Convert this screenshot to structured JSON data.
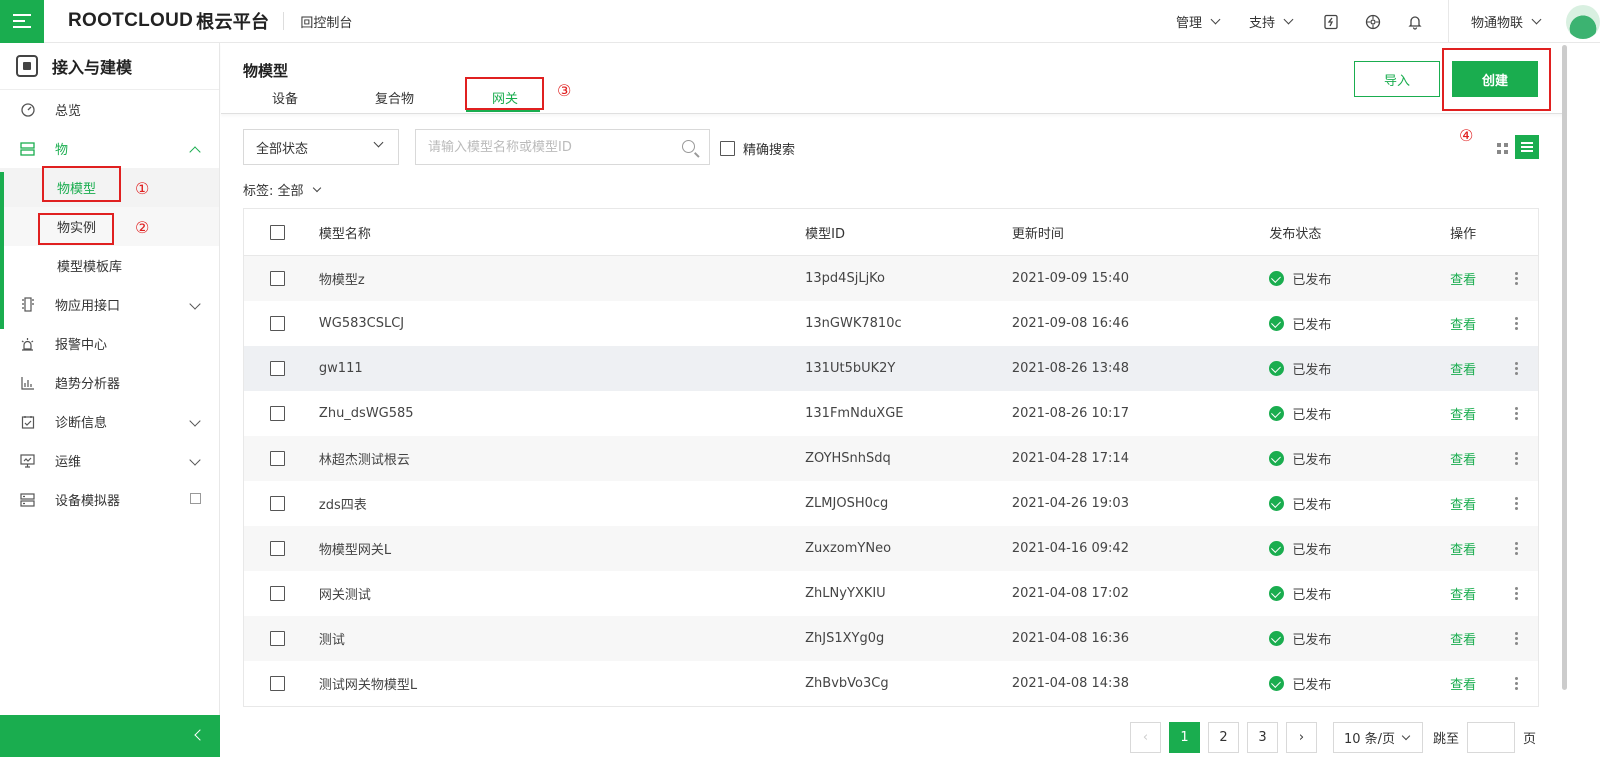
{
  "topbar": {
    "brand": "ROOTCLOUD",
    "brand_cn": "根云平台",
    "console": "回控制台",
    "manage": "管理",
    "support": "支持",
    "account": "物通物联"
  },
  "sidebar": {
    "title": "接入与建模",
    "items": [
      {
        "label": "总览"
      },
      {
        "label": "物"
      },
      {
        "label": "物应用接口"
      },
      {
        "label": "报警中心"
      },
      {
        "label": "趋势分析器"
      },
      {
        "label": "诊断信息"
      },
      {
        "label": "运维"
      },
      {
        "label": "设备模拟器"
      }
    ],
    "sub_items": [
      {
        "label": "物模型"
      },
      {
        "label": "物实例"
      },
      {
        "label": "模型模板库"
      }
    ]
  },
  "main": {
    "title": "物模型",
    "tabs": [
      {
        "label": "设备"
      },
      {
        "label": "复合物"
      },
      {
        "label": "网关"
      }
    ],
    "import_label": "导入",
    "create_label": "创建"
  },
  "annotations": [
    "①",
    "②",
    "③",
    "④"
  ],
  "filters": {
    "status": "全部状态",
    "search_placeholder": "请输入模型名称或模型ID",
    "precise": "精确搜索",
    "tags_label": "标签: 全部"
  },
  "table": {
    "columns": [
      "模型名称",
      "模型ID",
      "更新时间",
      "发布状态",
      "操作"
    ],
    "rows": [
      {
        "name": "物模型z",
        "id": "13pd4SjLjKo",
        "time": "2021-09-09 15:40",
        "status": "已发布",
        "op": "查看"
      },
      {
        "name": "WG583CSLCJ",
        "id": "13nGWK7810c",
        "time": "2021-09-08 16:46",
        "status": "已发布",
        "op": "查看"
      },
      {
        "name": "gw111",
        "id": "131Ut5bUK2Y",
        "time": "2021-08-26 13:48",
        "status": "已发布",
        "op": "查看"
      },
      {
        "name": "Zhu_dsWG585",
        "id": "131FmNduXGE",
        "time": "2021-08-26 10:17",
        "status": "已发布",
        "op": "查看"
      },
      {
        "name": "林超杰测试根云",
        "id": "ZOYHSnhSdq",
        "time": "2021-04-28 17:14",
        "status": "已发布",
        "op": "查看"
      },
      {
        "name": "zds四表",
        "id": "ZLMJOSH0cg",
        "time": "2021-04-26 19:03",
        "status": "已发布",
        "op": "查看"
      },
      {
        "name": "物模型网关L",
        "id": "ZuxzomYNeo",
        "time": "2021-04-16 09:42",
        "status": "已发布",
        "op": "查看"
      },
      {
        "name": "网关测试",
        "id": "ZhLNyYXKIU",
        "time": "2021-04-08 17:02",
        "status": "已发布",
        "op": "查看"
      },
      {
        "name": "测试",
        "id": "ZhJS1XYg0g",
        "time": "2021-04-08 16:36",
        "status": "已发布",
        "op": "查看"
      },
      {
        "name": "测试网关物模型L",
        "id": "ZhBvbVo3Cg",
        "time": "2021-04-08 14:38",
        "status": "已发布",
        "op": "查看"
      }
    ]
  },
  "pagination": {
    "prev": "‹",
    "pages": [
      "1",
      "2",
      "3"
    ],
    "next": "›",
    "page_size": "10 条/页",
    "jump_label": "跳至",
    "page_unit": "页"
  },
  "colors": {
    "accent": "#1aad4f",
    "annotation": "#e02020"
  }
}
